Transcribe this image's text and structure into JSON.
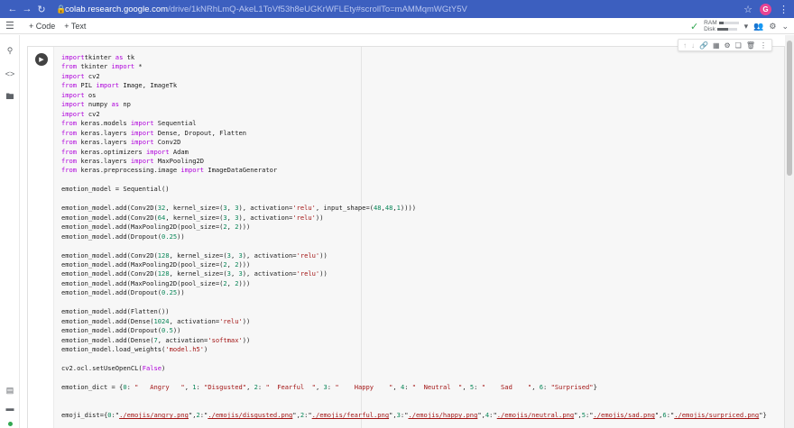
{
  "browser": {
    "url_host": "colab.research.google.com",
    "url_path": "/drive/1kNRhLmQ-AkeL1ToVf53h8eUGKrWFLEty#scrollTo=mAMMqmWGtY5V",
    "profile_initial": "G"
  },
  "toolbar": {
    "add_code_label": "+ Code",
    "add_text_label": "+ Text",
    "ram_label": "RAM",
    "disk_label": "Disk",
    "ram_usage": 0.25,
    "disk_usage": 0.55
  },
  "code_lines": [
    [
      [
        "kw",
        "import"
      ],
      [
        "",
        "tkinter "
      ],
      [
        "kw",
        "as"
      ],
      [
        "",
        " tk"
      ]
    ],
    [
      [
        "kw",
        "from"
      ],
      [
        "",
        " tkinter "
      ],
      [
        "kw",
        "import"
      ],
      [
        "",
        " *"
      ]
    ],
    [
      [
        "kw",
        "import"
      ],
      [
        "",
        " cv2"
      ]
    ],
    [
      [
        "kw",
        "from"
      ],
      [
        "",
        " PIL "
      ],
      [
        "kw",
        "import"
      ],
      [
        "",
        " Image, ImageTk"
      ]
    ],
    [
      [
        "kw",
        "import"
      ],
      [
        "",
        " os"
      ]
    ],
    [
      [
        "kw",
        "import"
      ],
      [
        "",
        " numpy "
      ],
      [
        "kw",
        "as"
      ],
      [
        "",
        " np"
      ]
    ],
    [
      [
        "kw",
        "import"
      ],
      [
        "",
        " cv2"
      ]
    ],
    [
      [
        "kw",
        "from"
      ],
      [
        "",
        " keras.models "
      ],
      [
        "kw",
        "import"
      ],
      [
        "",
        " Sequential"
      ]
    ],
    [
      [
        "kw",
        "from"
      ],
      [
        "",
        " keras.layers "
      ],
      [
        "kw",
        "import"
      ],
      [
        "",
        " Dense, Dropout, Flatten"
      ]
    ],
    [
      [
        "kw",
        "from"
      ],
      [
        "",
        " keras.layers "
      ],
      [
        "kw",
        "import"
      ],
      [
        "",
        " Conv2D"
      ]
    ],
    [
      [
        "kw",
        "from"
      ],
      [
        "",
        " keras.optimizers "
      ],
      [
        "kw",
        "import"
      ],
      [
        "",
        " Adam"
      ]
    ],
    [
      [
        "kw",
        "from"
      ],
      [
        "",
        " keras.layers "
      ],
      [
        "kw",
        "import"
      ],
      [
        "",
        " MaxPooling2D"
      ]
    ],
    [
      [
        "kw",
        "from"
      ],
      [
        "",
        " keras.preprocessing.image "
      ],
      [
        "kw",
        "import"
      ],
      [
        "",
        " ImageDataGenerator"
      ]
    ],
    [],
    [
      [
        "",
        "emotion_model = Sequential()"
      ]
    ],
    [],
    [
      [
        "",
        "emotion_model.add(Conv2D("
      ],
      [
        "num",
        "32"
      ],
      [
        "",
        ", kernel_size=("
      ],
      [
        "num",
        "3"
      ],
      [
        "",
        ", "
      ],
      [
        "num",
        "3"
      ],
      [
        "",
        "), activation="
      ],
      [
        "str",
        "'relu'"
      ],
      [
        "",
        ", input_shape=("
      ],
      [
        "num",
        "48"
      ],
      [
        "",
        ","
      ],
      [
        "num",
        "48"
      ],
      [
        "",
        ","
      ],
      [
        "num",
        "1"
      ],
      [
        "",
        "))))"
      ]
    ],
    [
      [
        "",
        "emotion_model.add(Conv2D("
      ],
      [
        "num",
        "64"
      ],
      [
        "",
        ", kernel_size=("
      ],
      [
        "num",
        "3"
      ],
      [
        "",
        ", "
      ],
      [
        "num",
        "3"
      ],
      [
        "",
        "), activation="
      ],
      [
        "str",
        "'relu'"
      ],
      [
        "",
        "))"
      ]
    ],
    [
      [
        "",
        "emotion_model.add(MaxPooling2D(pool_size=("
      ],
      [
        "num",
        "2"
      ],
      [
        "",
        ", "
      ],
      [
        "num",
        "2"
      ],
      [
        "",
        ")))"
      ]
    ],
    [
      [
        "",
        "emotion_model.add(Dropout("
      ],
      [
        "num",
        "0.25"
      ],
      [
        "",
        "))"
      ]
    ],
    [],
    [
      [
        "",
        "emotion_model.add(Conv2D("
      ],
      [
        "num",
        "128"
      ],
      [
        "",
        ", kernel_size=("
      ],
      [
        "num",
        "3"
      ],
      [
        "",
        ", "
      ],
      [
        "num",
        "3"
      ],
      [
        "",
        "), activation="
      ],
      [
        "str",
        "'relu'"
      ],
      [
        "",
        "))"
      ]
    ],
    [
      [
        "",
        "emotion_model.add(MaxPooling2D(pool_size=("
      ],
      [
        "num",
        "2"
      ],
      [
        "",
        ", "
      ],
      [
        "num",
        "2"
      ],
      [
        "",
        ")))"
      ]
    ],
    [
      [
        "",
        "emotion_model.add(Conv2D("
      ],
      [
        "num",
        "128"
      ],
      [
        "",
        ", kernel_size=("
      ],
      [
        "num",
        "3"
      ],
      [
        "",
        ", "
      ],
      [
        "num",
        "3"
      ],
      [
        "",
        "), activation="
      ],
      [
        "str",
        "'relu'"
      ],
      [
        "",
        "))"
      ]
    ],
    [
      [
        "",
        "emotion_model.add(MaxPooling2D(pool_size=("
      ],
      [
        "num",
        "2"
      ],
      [
        "",
        ", "
      ],
      [
        "num",
        "2"
      ],
      [
        "",
        ")))"
      ]
    ],
    [
      [
        "",
        "emotion_model.add(Dropout("
      ],
      [
        "num",
        "0.25"
      ],
      [
        "",
        "))"
      ]
    ],
    [],
    [
      [
        "",
        "emotion_model.add(Flatten())"
      ]
    ],
    [
      [
        "",
        "emotion_model.add(Dense("
      ],
      [
        "num",
        "1024"
      ],
      [
        "",
        ", activation="
      ],
      [
        "str",
        "'relu'"
      ],
      [
        "",
        "))"
      ]
    ],
    [
      [
        "",
        "emotion_model.add(Dropout("
      ],
      [
        "num",
        "0.5"
      ],
      [
        "",
        "))"
      ]
    ],
    [
      [
        "",
        "emotion_model.add(Dense("
      ],
      [
        "num",
        "7"
      ],
      [
        "",
        ", activation="
      ],
      [
        "str",
        "'softmax'"
      ],
      [
        "",
        "))"
      ]
    ],
    [
      [
        "",
        "emotion_model.load_weights("
      ],
      [
        "str",
        "'model.h5'"
      ],
      [
        "",
        ")"
      ]
    ],
    [],
    [
      [
        "",
        "cv2.ocl.setUseOpenCL("
      ],
      [
        "kw",
        "False"
      ],
      [
        "",
        ")"
      ]
    ],
    [],
    [
      [
        "",
        "emotion_dict = {"
      ],
      [
        "num",
        "0"
      ],
      [
        "",
        ": "
      ],
      [
        "str",
        "\"   Angry   \""
      ],
      [
        "",
        ", "
      ],
      [
        "num",
        "1"
      ],
      [
        "",
        ": "
      ],
      [
        "str",
        "\"Disgusted\""
      ],
      [
        "",
        ", "
      ],
      [
        "num",
        "2"
      ],
      [
        "",
        ": "
      ],
      [
        "str",
        "\"  Fearful  \""
      ],
      [
        "",
        ", "
      ],
      [
        "num",
        "3"
      ],
      [
        "",
        ": "
      ],
      [
        "str",
        "\"    Happy    \""
      ],
      [
        "",
        ", "
      ],
      [
        "num",
        "4"
      ],
      [
        "",
        ": "
      ],
      [
        "str",
        "\"  Neutral  \""
      ],
      [
        "",
        ", "
      ],
      [
        "num",
        "5"
      ],
      [
        "",
        ": "
      ],
      [
        "str",
        "\"    Sad    \""
      ],
      [
        "",
        ", "
      ],
      [
        "num",
        "6"
      ],
      [
        "",
        ": "
      ],
      [
        "str",
        "\"Surprised\""
      ],
      [
        "",
        "}"
      ]
    ],
    [],
    [],
    [
      [
        "",
        "emoji_dist={"
      ],
      [
        "num",
        "0"
      ],
      [
        "",
        ":\""
      ],
      [
        "lnk",
        "./emojis/angry.png"
      ],
      [
        "",
        "\","
      ],
      [
        "num",
        "2"
      ],
      [
        "",
        ":\""
      ],
      [
        "lnk",
        "./emojis/disgusted.png"
      ],
      [
        "",
        "\","
      ],
      [
        "num",
        "2"
      ],
      [
        "",
        ":\""
      ],
      [
        "lnk",
        "./emojis/fearful.png"
      ],
      [
        "",
        "\","
      ],
      [
        "num",
        "3"
      ],
      [
        "",
        ":\""
      ],
      [
        "lnk",
        "./emojis/happy.png"
      ],
      [
        "",
        "\","
      ],
      [
        "num",
        "4"
      ],
      [
        "",
        ":\""
      ],
      [
        "lnk",
        "./emojis/neutral.png"
      ],
      [
        "",
        "\","
      ],
      [
        "num",
        "5"
      ],
      [
        "",
        ":\""
      ],
      [
        "lnk",
        "./emojis/sad.png"
      ],
      [
        "",
        "\","
      ],
      [
        "num",
        "6"
      ],
      [
        "",
        ":\""
      ],
      [
        "lnk",
        "./emojis/surpriced.png"
      ],
      [
        "",
        "\"}"
      ]
    ]
  ]
}
